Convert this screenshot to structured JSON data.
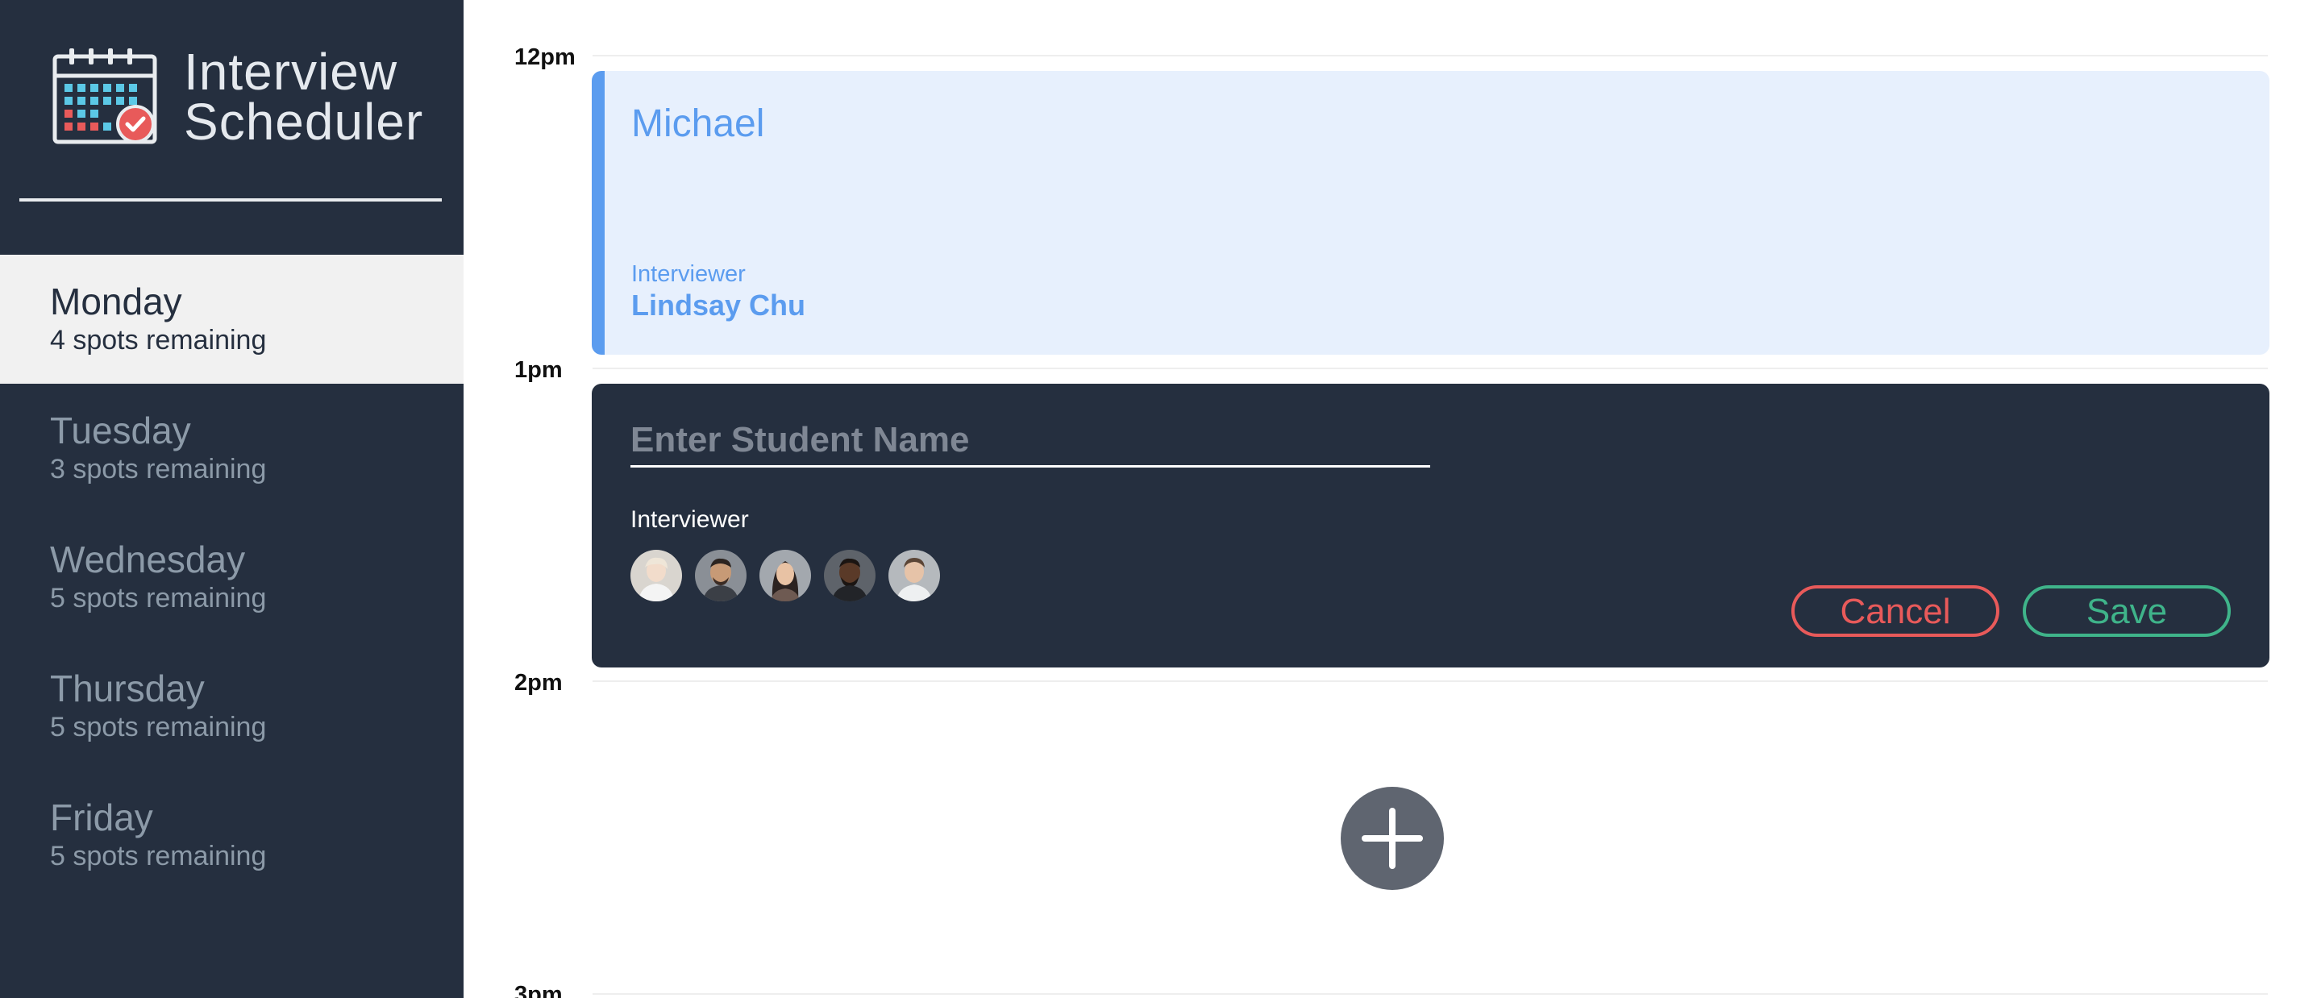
{
  "brand": {
    "title": "Interview\nScheduler",
    "logo_icon": "calendar-check-icon"
  },
  "sidebar": {
    "days": [
      {
        "name": "Monday",
        "spots": "4 spots remaining",
        "selected": true
      },
      {
        "name": "Tuesday",
        "spots": "3 spots remaining",
        "selected": false
      },
      {
        "name": "Wednesday",
        "spots": "5 spots remaining",
        "selected": false
      },
      {
        "name": "Thursday",
        "spots": "5 spots remaining",
        "selected": false
      },
      {
        "name": "Friday",
        "spots": "5 spots remaining",
        "selected": false
      }
    ]
  },
  "schedule": {
    "times": [
      "12pm",
      "1pm",
      "2pm",
      "3pm"
    ],
    "booked": {
      "student": "Michael",
      "interviewer_caption": "Interviewer",
      "interviewer_name": "Lindsay Chu"
    },
    "form": {
      "placeholder": "Enter Student Name",
      "value": "",
      "interviewer_caption": "Interviewer",
      "avatars": [
        "interviewer-avatar-1",
        "interviewer-avatar-2",
        "interviewer-avatar-3",
        "interviewer-avatar-4",
        "interviewer-avatar-5"
      ],
      "cancel_label": "Cancel",
      "save_label": "Save"
    },
    "add_icon": "plus-icon"
  },
  "colors": {
    "sidebar_bg": "#252f3f",
    "selected_day_bg": "#f1f1f1",
    "booked_bg": "#e7f0fd",
    "booked_accent": "#5b9cef",
    "cancel": "#e85a5a",
    "save": "#3fb48a",
    "add_button": "#5f6570"
  }
}
